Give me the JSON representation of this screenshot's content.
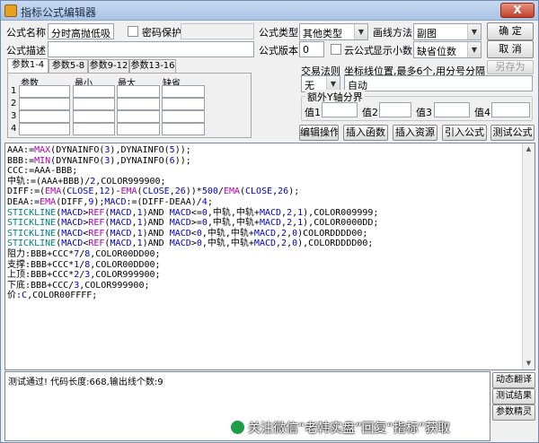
{
  "window": {
    "title": "指标公式编辑器",
    "close_label": "X"
  },
  "form": {
    "name_label": "公式名称",
    "name_value": "分时高抛低吸",
    "password_label": "密码保护",
    "type_label": "公式类型",
    "type_value": "其他类型",
    "draw_label": "画线方法",
    "draw_value": "副图",
    "desc_label": "公式描述",
    "version_label": "公式版本",
    "version_value": "0",
    "cloud_label": "云公式",
    "decimals_label": "显示小数",
    "decimals_value": "缺省位数",
    "confirm_button": "确  定",
    "cancel_button": "取  消",
    "saveas_button": "另存为"
  },
  "tabs": [
    "参数1-4",
    "参数5-8",
    "参数9-12",
    "参数13-16"
  ],
  "params": {
    "headers": [
      "参数",
      "最小",
      "最大",
      "缺省"
    ],
    "rows": [
      "1",
      "2",
      "3",
      "4"
    ]
  },
  "trading": {
    "label": "交易法则",
    "value": "无",
    "coord_label": "坐标线位置,最多6个,用分号分隔",
    "coord_value": "自动"
  },
  "yaxis": {
    "group_label": "额外Y轴分界",
    "labels": [
      "值1",
      "值2",
      "值3",
      "值4"
    ]
  },
  "actions": [
    "编辑操作",
    "插入函数",
    "插入资源",
    "引入公式",
    "测试公式"
  ],
  "code_lines": [
    [
      {
        "t": "AAA:=",
        "c": "black"
      },
      {
        "t": "MAX",
        "c": "kw"
      },
      {
        "t": "(DYNAINFO(",
        "c": "black"
      },
      {
        "t": "3",
        "c": "num"
      },
      {
        "t": "),DYNAINFO(",
        "c": "black"
      },
      {
        "t": "5",
        "c": "num"
      },
      {
        "t": "));",
        "c": "black"
      }
    ],
    [
      {
        "t": "BBB:=",
        "c": "black"
      },
      {
        "t": "MIN",
        "c": "kw"
      },
      {
        "t": "(DYNAINFO(",
        "c": "black"
      },
      {
        "t": "3",
        "c": "num"
      },
      {
        "t": "),DYNAINFO(",
        "c": "black"
      },
      {
        "t": "6",
        "c": "num"
      },
      {
        "t": "));",
        "c": "black"
      }
    ],
    [
      {
        "t": "CCC:=AAA-BBB;",
        "c": "black"
      }
    ],
    [
      {
        "t": "中轨:=(AAA+BBB)/",
        "c": "black"
      },
      {
        "t": "2",
        "c": "num"
      },
      {
        "t": ",COLOR999900;",
        "c": "black"
      }
    ],
    [
      {
        "t": "DIFF:=(",
        "c": "black"
      },
      {
        "t": "EMA",
        "c": "kw"
      },
      {
        "t": "(",
        "c": "black"
      },
      {
        "t": "CLOSE",
        "c": "var"
      },
      {
        "t": ",",
        "c": "black"
      },
      {
        "t": "12",
        "c": "num"
      },
      {
        "t": ")-",
        "c": "black"
      },
      {
        "t": "EMA",
        "c": "kw"
      },
      {
        "t": "(",
        "c": "black"
      },
      {
        "t": "CLOSE",
        "c": "var"
      },
      {
        "t": ",",
        "c": "black"
      },
      {
        "t": "26",
        "c": "num"
      },
      {
        "t": "))*",
        "c": "black"
      },
      {
        "t": "500",
        "c": "num"
      },
      {
        "t": "/",
        "c": "black"
      },
      {
        "t": "EMA",
        "c": "kw"
      },
      {
        "t": "(",
        "c": "black"
      },
      {
        "t": "CLOSE",
        "c": "var"
      },
      {
        "t": ",",
        "c": "black"
      },
      {
        "t": "26",
        "c": "num"
      },
      {
        "t": ");",
        "c": "black"
      }
    ],
    [
      {
        "t": "DEAA:=",
        "c": "black"
      },
      {
        "t": "EMA",
        "c": "kw"
      },
      {
        "t": "(DIFF,",
        "c": "black"
      },
      {
        "t": "9",
        "c": "num"
      },
      {
        "t": ");",
        "c": "black"
      },
      {
        "t": "MACD",
        "c": "var"
      },
      {
        "t": ":=(DIFF-DEAA)/",
        "c": "black"
      },
      {
        "t": "4",
        "c": "num"
      },
      {
        "t": ";",
        "c": "black"
      }
    ],
    [
      {
        "t": "STICKLINE",
        "c": "teal"
      },
      {
        "t": "(",
        "c": "black"
      },
      {
        "t": "MACD",
        "c": "var"
      },
      {
        "t": ">",
        "c": "black"
      },
      {
        "t": "REF",
        "c": "kw"
      },
      {
        "t": "(",
        "c": "black"
      },
      {
        "t": "MACD",
        "c": "var"
      },
      {
        "t": ",",
        "c": "black"
      },
      {
        "t": "1",
        "c": "num"
      },
      {
        "t": ")AND ",
        "c": "black"
      },
      {
        "t": "MACD",
        "c": "var"
      },
      {
        "t": "<=",
        "c": "black"
      },
      {
        "t": "0",
        "c": "num"
      },
      {
        "t": ",中轨,中轨+",
        "c": "black"
      },
      {
        "t": "MACD",
        "c": "var"
      },
      {
        "t": ",",
        "c": "black"
      },
      {
        "t": "2",
        "c": "num"
      },
      {
        "t": ",",
        "c": "black"
      },
      {
        "t": "1",
        "c": "num"
      },
      {
        "t": "),COLOR009999;",
        "c": "black"
      }
    ],
    [
      {
        "t": "STICKLINE",
        "c": "teal"
      },
      {
        "t": "(",
        "c": "black"
      },
      {
        "t": "MACD",
        "c": "var"
      },
      {
        "t": ">",
        "c": "black"
      },
      {
        "t": "REF",
        "c": "kw"
      },
      {
        "t": "(",
        "c": "black"
      },
      {
        "t": "MACD",
        "c": "var"
      },
      {
        "t": ",",
        "c": "black"
      },
      {
        "t": "1",
        "c": "num"
      },
      {
        "t": ")AND ",
        "c": "black"
      },
      {
        "t": "MACD",
        "c": "var"
      },
      {
        "t": ">=",
        "c": "black"
      },
      {
        "t": "0",
        "c": "num"
      },
      {
        "t": ",中轨,中轨+",
        "c": "black"
      },
      {
        "t": "MACD",
        "c": "var"
      },
      {
        "t": ",",
        "c": "black"
      },
      {
        "t": "2",
        "c": "num"
      },
      {
        "t": ",",
        "c": "black"
      },
      {
        "t": "1",
        "c": "num"
      },
      {
        "t": "),COLOR0000DD;",
        "c": "black"
      }
    ],
    [
      {
        "t": "STICKLINE",
        "c": "teal"
      },
      {
        "t": "(",
        "c": "black"
      },
      {
        "t": "MACD",
        "c": "var"
      },
      {
        "t": "<",
        "c": "black"
      },
      {
        "t": "REF",
        "c": "kw"
      },
      {
        "t": "(",
        "c": "black"
      },
      {
        "t": "MACD",
        "c": "var"
      },
      {
        "t": ",",
        "c": "black"
      },
      {
        "t": "1",
        "c": "num"
      },
      {
        "t": ")AND ",
        "c": "black"
      },
      {
        "t": "MACD",
        "c": "var"
      },
      {
        "t": "<",
        "c": "black"
      },
      {
        "t": "0",
        "c": "num"
      },
      {
        "t": ",中轨,中轨+",
        "c": "black"
      },
      {
        "t": "MACD",
        "c": "var"
      },
      {
        "t": ",",
        "c": "black"
      },
      {
        "t": "2",
        "c": "num"
      },
      {
        "t": ",",
        "c": "black"
      },
      {
        "t": "0",
        "c": "num"
      },
      {
        "t": ")COLORDDDD00;",
        "c": "black"
      }
    ],
    [
      {
        "t": "STICKLINE",
        "c": "teal"
      },
      {
        "t": "(",
        "c": "black"
      },
      {
        "t": "MACD",
        "c": "var"
      },
      {
        "t": "<",
        "c": "black"
      },
      {
        "t": "REF",
        "c": "kw"
      },
      {
        "t": "(",
        "c": "black"
      },
      {
        "t": "MACD",
        "c": "var"
      },
      {
        "t": ",",
        "c": "black"
      },
      {
        "t": "1",
        "c": "num"
      },
      {
        "t": ")AND ",
        "c": "black"
      },
      {
        "t": "MACD",
        "c": "var"
      },
      {
        "t": ">",
        "c": "black"
      },
      {
        "t": "0",
        "c": "num"
      },
      {
        "t": ",中轨,中轨+",
        "c": "black"
      },
      {
        "t": "MACD",
        "c": "var"
      },
      {
        "t": ",",
        "c": "black"
      },
      {
        "t": "2",
        "c": "num"
      },
      {
        "t": ",",
        "c": "black"
      },
      {
        "t": "0",
        "c": "num"
      },
      {
        "t": "),COLORDDDD00;",
        "c": "black"
      }
    ],
    [
      {
        "t": "阻力:BBB+CCC*",
        "c": "black"
      },
      {
        "t": "7",
        "c": "num"
      },
      {
        "t": "/",
        "c": "black"
      },
      {
        "t": "8",
        "c": "num"
      },
      {
        "t": ",COLOR00DD00;",
        "c": "black"
      }
    ],
    [
      {
        "t": "支撑:BBB+CCC*",
        "c": "black"
      },
      {
        "t": "1",
        "c": "num"
      },
      {
        "t": "/",
        "c": "black"
      },
      {
        "t": "8",
        "c": "num"
      },
      {
        "t": ",COLOR00DD00;",
        "c": "black"
      }
    ],
    [
      {
        "t": "上顶:BBB+CCC*",
        "c": "black"
      },
      {
        "t": "2",
        "c": "num"
      },
      {
        "t": "/",
        "c": "black"
      },
      {
        "t": "3",
        "c": "num"
      },
      {
        "t": ",COLOR999900;",
        "c": "black"
      }
    ],
    [
      {
        "t": "下底:BBB+CCC/",
        "c": "black"
      },
      {
        "t": "3",
        "c": "num"
      },
      {
        "t": ",COLOR999900;",
        "c": "black"
      }
    ],
    [
      {
        "t": "价:",
        "c": "black"
      },
      {
        "t": "C",
        "c": "var"
      },
      {
        "t": ",COLOR00FFFF;",
        "c": "black"
      }
    ]
  ],
  "status": {
    "text": "测试通过! 代码长度:668,输出线个数:9"
  },
  "side_buttons": [
    "动态翻译",
    "测试结果",
    "参数精灵"
  ],
  "watermark": "关注微信“老韩实盘”回复“指标”获取"
}
